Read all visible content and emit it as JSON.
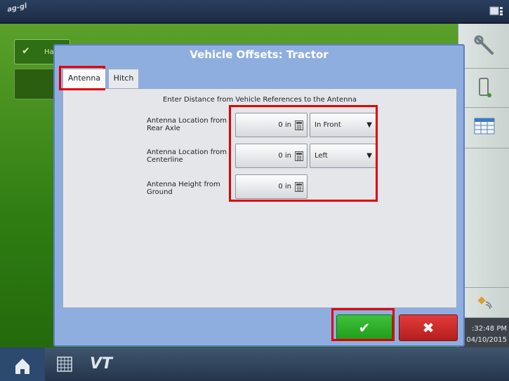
{
  "topbar": {
    "logo_text": "ag-gl"
  },
  "background": {
    "row_label": "Ha"
  },
  "dialog": {
    "title": "Vehicle Offsets: Tractor",
    "tabs": [
      {
        "label": "Antenna",
        "active": true
      },
      {
        "label": "Hitch",
        "active": false
      }
    ],
    "instruction": "Enter Distance from Vehicle References to the Antenna",
    "fields": [
      {
        "label": "Antenna Location from Rear Axle",
        "value": "0 in",
        "select": "In Front"
      },
      {
        "label": "Antenna Location from Centerline",
        "value": "0 in",
        "select": "Left"
      },
      {
        "label": "Antenna Height from Ground",
        "value": "0 in"
      }
    ],
    "ok_icon": "✔",
    "cancel_icon": "✖"
  },
  "side_panel": {
    "time": ":32:48 PM",
    "date": "04/10/2015",
    "icons": [
      "wrench-icon",
      "device-icon",
      "table-icon",
      "satellite-icon"
    ]
  },
  "bottombar": {
    "vt_label": "VT"
  },
  "colors": {
    "dialog_bg": "#8faee0",
    "ok_green": "#2bae26",
    "cancel_red": "#c92a2a",
    "highlight_red": "#e00000",
    "background_green": "#3f8a18"
  }
}
